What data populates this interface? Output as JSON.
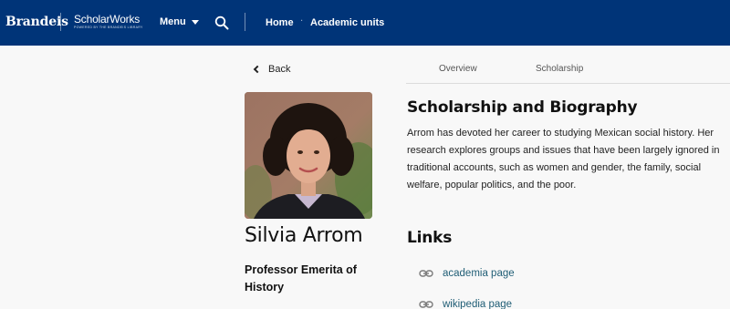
{
  "header": {
    "brand": "Brandeis",
    "app_title": "ScholarWorks",
    "app_subtitle": "POWERED BY THE BRANDEIS LIBRARY",
    "menu_label": "Menu",
    "breadcrumbs": [
      "Home",
      "Academic units"
    ]
  },
  "nav": {
    "back_label": "Back",
    "tabs": [
      {
        "label": "Overview",
        "active": false
      },
      {
        "label": "Scholarship",
        "active": false
      }
    ]
  },
  "profile": {
    "name": "Silvia Arrom",
    "title": "Professor Emerita of History",
    "photo_icon": "portrait-photo"
  },
  "scholarship": {
    "heading": "Scholarship and Biography",
    "bio": "Arrom has devoted her career to studying Mexican social history. Her research explores groups and issues that have been largely ignored in traditional accounts, such as women and gender, the family, social welfare, popular politics, and the poor."
  },
  "links": {
    "heading": "Links",
    "items": [
      {
        "label": "academia page",
        "icon": "link-icon"
      },
      {
        "label": "wikipedia page",
        "icon": "link-icon"
      }
    ]
  },
  "colors": {
    "header_bg": "#003478",
    "page_bg": "#f8f8f8",
    "link": "#1f5d75"
  }
}
